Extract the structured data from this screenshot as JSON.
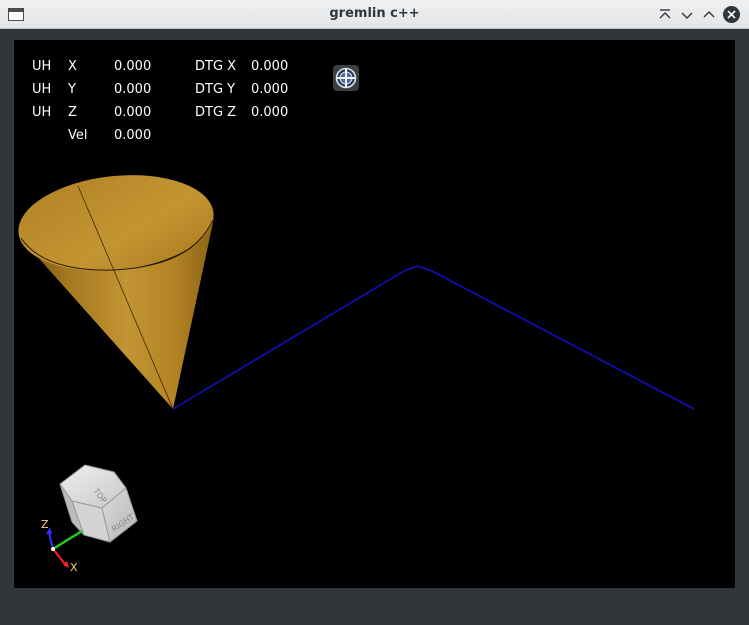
{
  "window": {
    "title": "gremlin c++",
    "buttons": [
      "keep-above",
      "minimize",
      "maximize",
      "close"
    ]
  },
  "dro": {
    "rows": [
      {
        "prefix": "UH",
        "axis": "X",
        "value": "0.000",
        "dtg_label": "DTG X",
        "dtg_value": "0.000"
      },
      {
        "prefix": "UH",
        "axis": "Y",
        "value": "0.000",
        "dtg_label": "DTG Y",
        "dtg_value": "0.000"
      },
      {
        "prefix": "UH",
        "axis": "Z",
        "value": "0.000",
        "dtg_label": "DTG Z",
        "dtg_value": "0.000"
      }
    ],
    "vel": {
      "label": "Vel",
      "value": "0.000"
    }
  },
  "view_cube": {
    "top_label": "TOP",
    "right_label": "RIGHT"
  },
  "triad": {
    "z_label": "Z",
    "x_label": "X"
  },
  "colors": {
    "path": "#1010c0",
    "tool": "#b8872a",
    "axis_x": "#ff2020",
    "axis_y": "#20d020",
    "axis_z": "#3030ff",
    "axis_label": "#ffd070"
  }
}
